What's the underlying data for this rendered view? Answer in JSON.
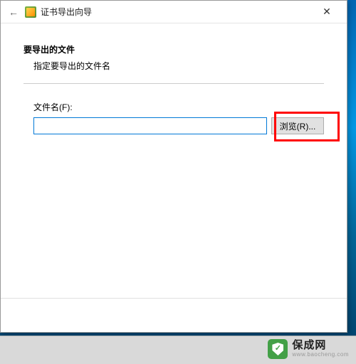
{
  "wizard": {
    "title": "证书导出向导",
    "section_heading": "要导出的文件",
    "section_sub": "指定要导出的文件名",
    "field_label": "文件名(F):",
    "file_value": "",
    "browse_label": "浏览(R)..."
  },
  "window": {
    "close": "✕",
    "back": "←"
  },
  "watermark": {
    "brand": "保成网",
    "url": "www.baocheng.com"
  }
}
